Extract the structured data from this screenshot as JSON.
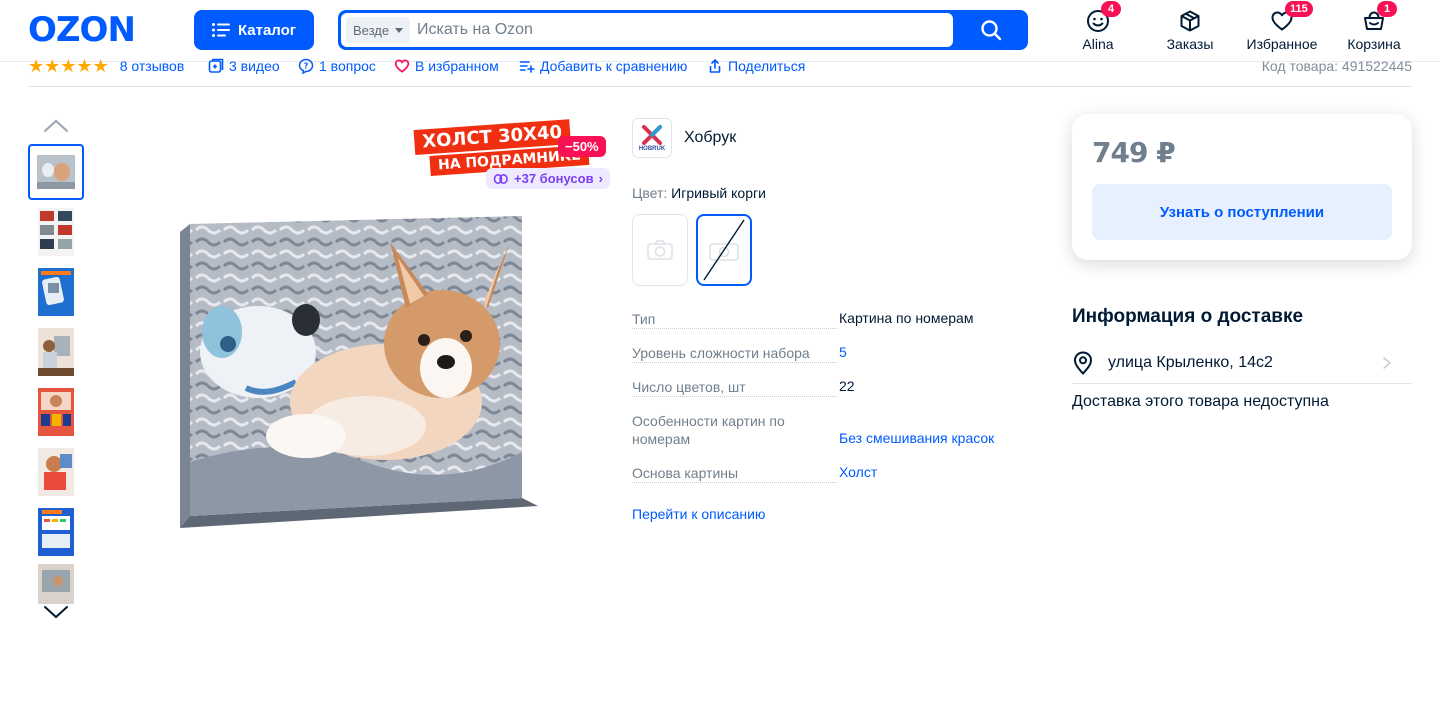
{
  "header": {
    "logo": "OZON",
    "catalog_label": "Каталог",
    "search": {
      "scope": "Везде",
      "placeholder": "Искать на Ozon",
      "value": ""
    },
    "nav": [
      {
        "label": "Alina",
        "icon": "profile-smile-icon",
        "badge": "4"
      },
      {
        "label": "Заказы",
        "icon": "box-icon",
        "badge": ""
      },
      {
        "label": "Избранное",
        "icon": "heart-icon",
        "badge": "115"
      },
      {
        "label": "Корзина",
        "icon": "cart-icon",
        "badge": "1"
      }
    ]
  },
  "strip": {
    "rating_stars": 5,
    "reviews": "8 отзывов",
    "videos": "3 видео",
    "questions": "1 вопрос",
    "favorite": "В избранном",
    "compare": "Добавить к сравнению",
    "share": "Поделиться",
    "sku": "Код товара: 491522445"
  },
  "gallery": {
    "promo_line1": "ХОЛСТ 30Х40",
    "promo_line2": "НА ПОДРАМНИКЕ",
    "discount": "−50%",
    "bonus": "+37 бонусов",
    "thumbnails": 8,
    "active_thumbnail": 0
  },
  "product": {
    "brand": "Хобрук",
    "brand_logo_text": "HOBRUK",
    "color_label": "Цвет:",
    "color_value": "Игривый корги",
    "specs": [
      {
        "key": "Тип",
        "value": "Картина по номерам",
        "link": false
      },
      {
        "key": "Уровень сложности набора",
        "value": "5",
        "link": true
      },
      {
        "key": "Число цветов, шт",
        "value": "22",
        "link": false
      },
      {
        "key": "Особенности картин по номерам",
        "value": "Без смешивания красок",
        "link": true
      },
      {
        "key": "Основа картины",
        "value": "Холст",
        "link": true
      }
    ],
    "goto_description": "Перейти к описанию"
  },
  "buy": {
    "price": "749 ₽",
    "notify_label": "Узнать о поступлении"
  },
  "delivery": {
    "title": "Информация о доставке",
    "address": "улица Крыленко, 14с2",
    "status": "Доставка этого товара недоступна"
  },
  "colors": {
    "brand": "#005bff",
    "badge": "#f91155",
    "star": "#ffa800",
    "bonus": "#7b3ff2"
  }
}
